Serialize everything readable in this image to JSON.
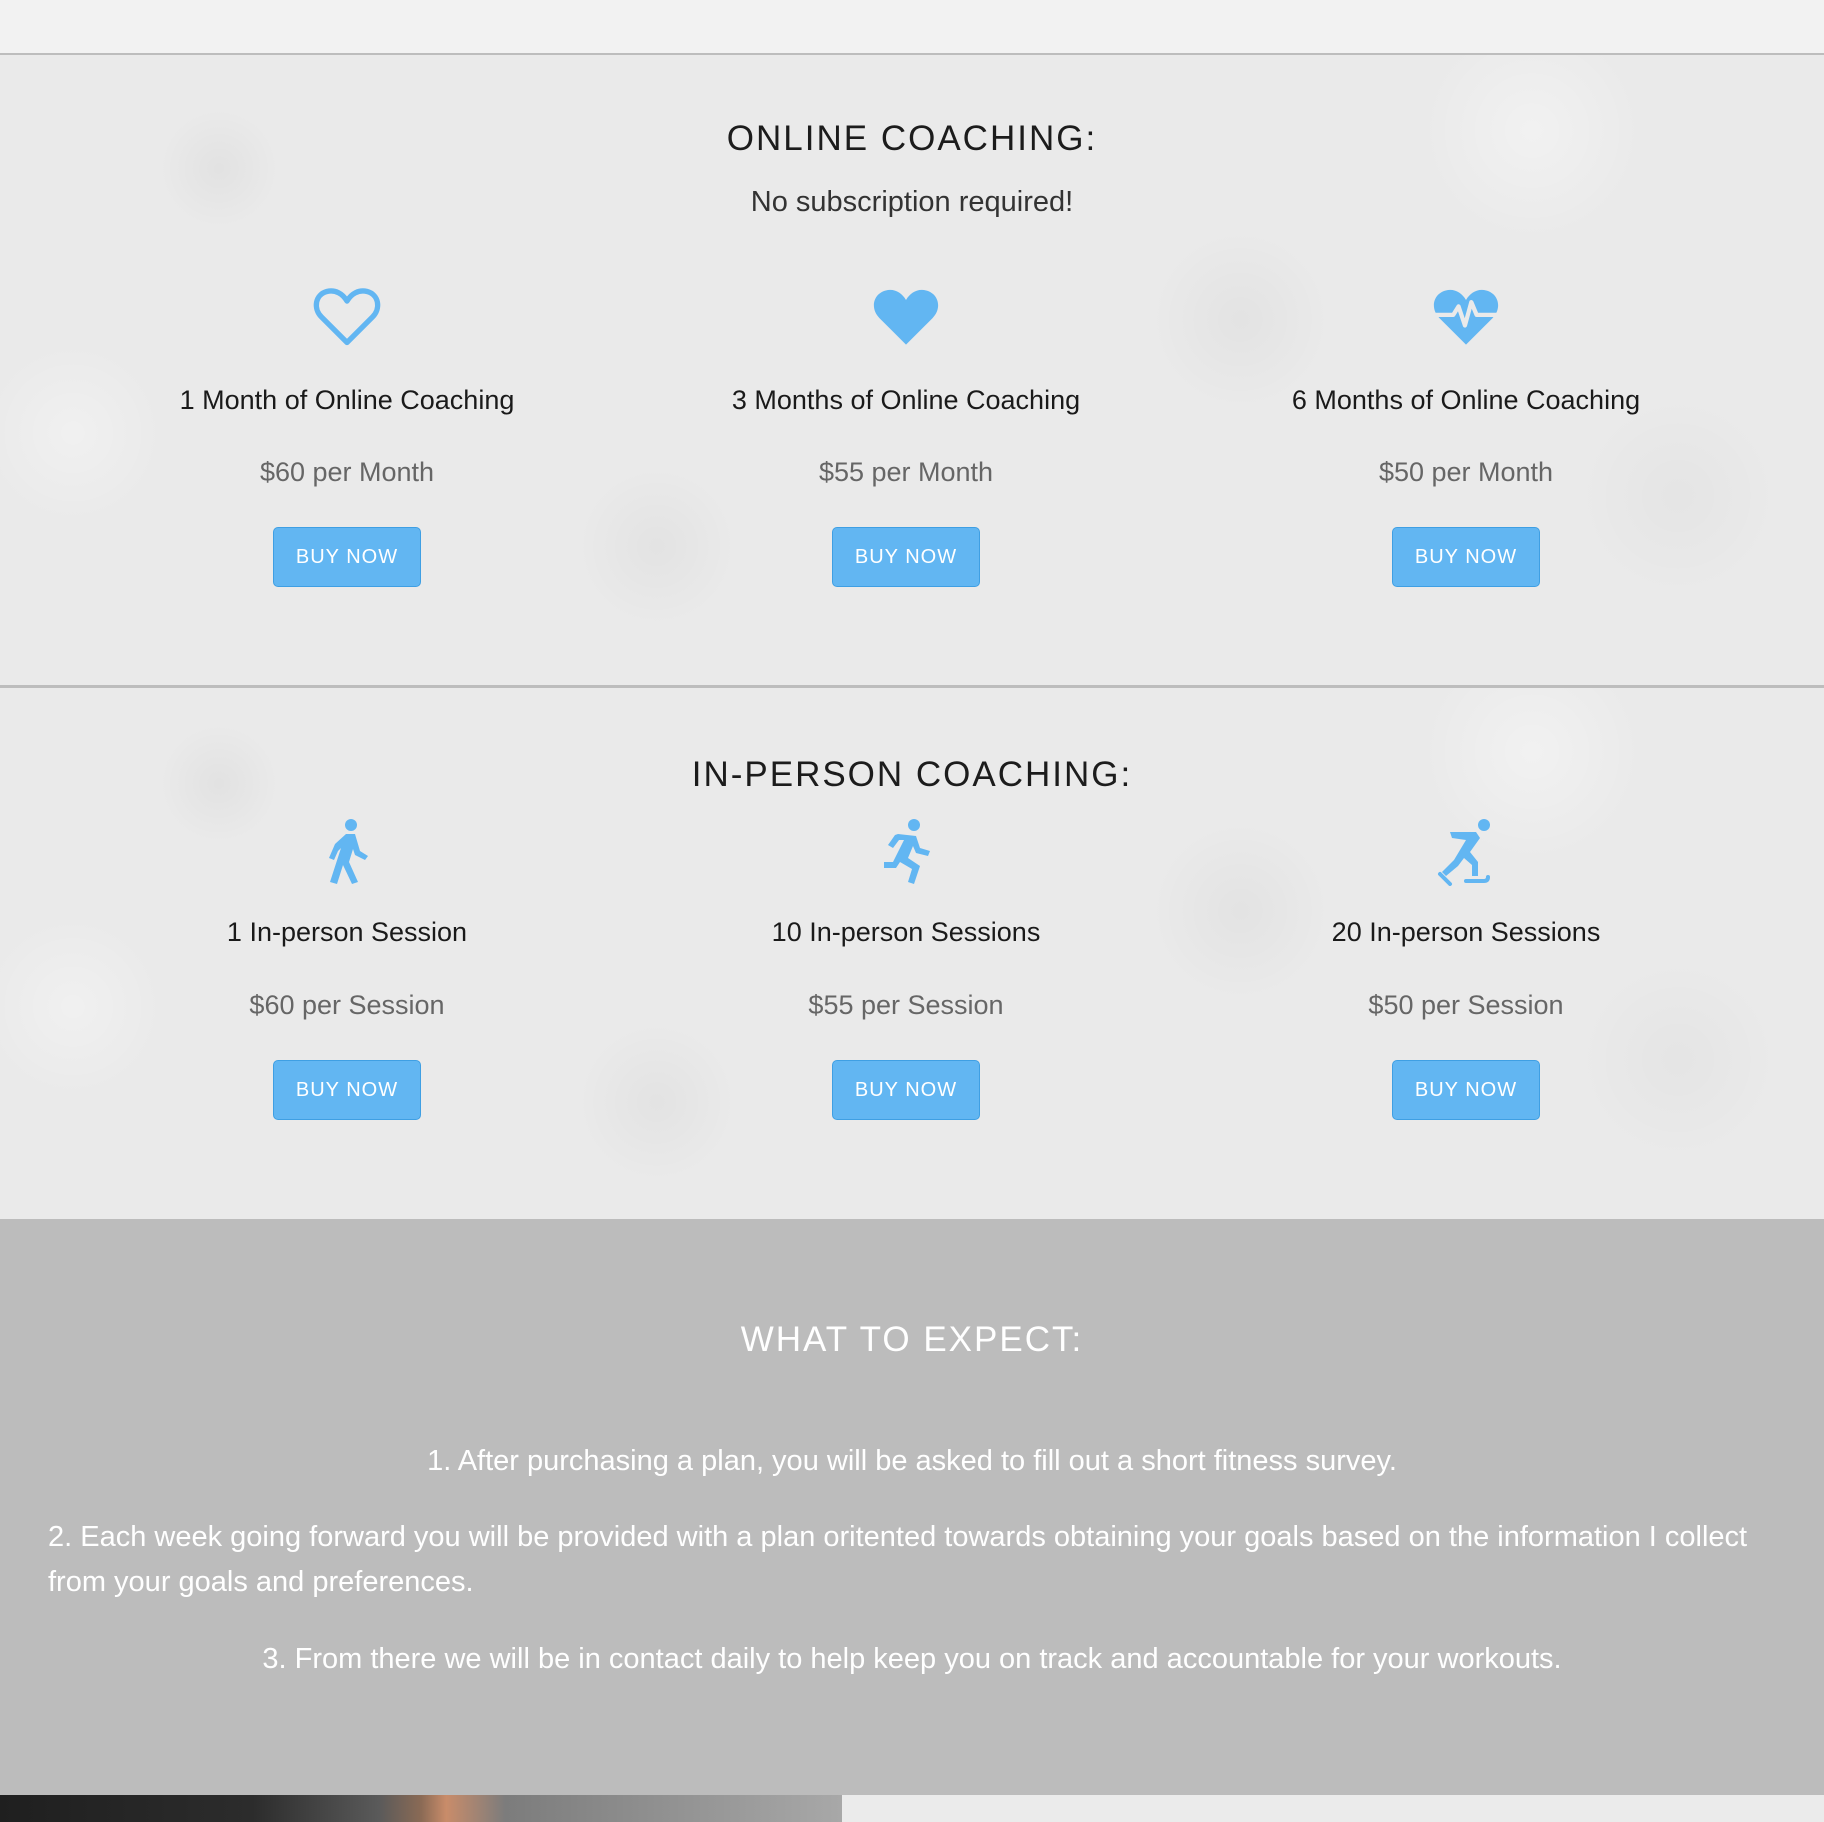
{
  "online": {
    "title": "ONLINE COACHING:",
    "subtitle": "No subscription required!",
    "plans": [
      {
        "icon": "heart-outline-icon",
        "name": "1 Month of Online Coaching",
        "price": "$60 per Month",
        "button": "BUY NOW"
      },
      {
        "icon": "heart-filled-icon",
        "name": "3 Months of Online Coaching",
        "price": "$55 per Month",
        "button": "BUY NOW"
      },
      {
        "icon": "heartbeat-icon",
        "name": "6 Months of Online Coaching",
        "price": "$50 per Month",
        "button": "BUY NOW"
      }
    ]
  },
  "inperson": {
    "title": "IN-PERSON COACHING:",
    "plans": [
      {
        "icon": "walking-icon",
        "name": "1 In-person Session",
        "price": "$60 per Session",
        "button": "BUY NOW"
      },
      {
        "icon": "running-icon",
        "name": "10 In-person Sessions",
        "price": "$55 per Session",
        "button": "BUY NOW"
      },
      {
        "icon": "skating-icon",
        "name": "20 In-person Sessions",
        "price": "$50 per Session",
        "button": "BUY NOW"
      }
    ]
  },
  "expect": {
    "title": "WHAT TO EXPECT:",
    "items": [
      "1. After purchasing a plan, you will be asked to fill out a short fitness survey.",
      "2. Each week going forward you will be provided with a plan oritented towards obtaining your goals based on the information I collect from your goals and preferences.",
      "3. From there we will be in contact daily to help keep you on track and accountable for your workouts."
    ]
  },
  "colors": {
    "accent": "#62b6f2",
    "button_border": "#3f9fe3",
    "expect_background": "#bcbcbc",
    "heading_text": "#1c1c1c",
    "price_text": "#666666"
  }
}
